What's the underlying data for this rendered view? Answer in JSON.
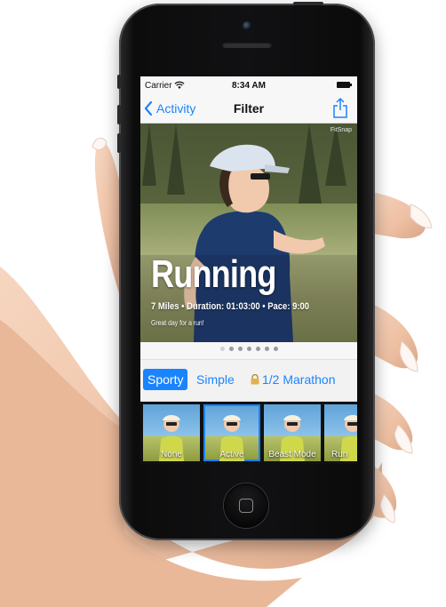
{
  "status_bar": {
    "carrier": "Carrier",
    "time": "8:34 AM"
  },
  "nav": {
    "back_label": "Activity",
    "title": "Filter"
  },
  "photo": {
    "watermark": "FitSnap",
    "headline": "Running",
    "stats": "7 Miles • Duration: 01:03:00 • Pace: 9:00",
    "caption": "Great day for a run!"
  },
  "pager": {
    "count": 7,
    "active_index": 0
  },
  "filter_tabs": [
    {
      "label": "Sporty",
      "selected": true
    },
    {
      "label": "Simple",
      "selected": false
    },
    {
      "label": "1/2 Marathon",
      "selected": false,
      "locked": true
    }
  ],
  "thumbnails": [
    {
      "label": "None",
      "selected": false
    },
    {
      "label": "Active",
      "selected": true
    },
    {
      "label": "Beast Mode",
      "selected": false
    },
    {
      "label": "Run",
      "selected": false
    }
  ],
  "colors": {
    "accent": "#1a84ff",
    "phone_body": "#111113",
    "skin": "#f1c9ad"
  },
  "icons": [
    "wifi-icon",
    "battery-icon",
    "chevron-left-icon",
    "share-icon",
    "lock-icon"
  ]
}
